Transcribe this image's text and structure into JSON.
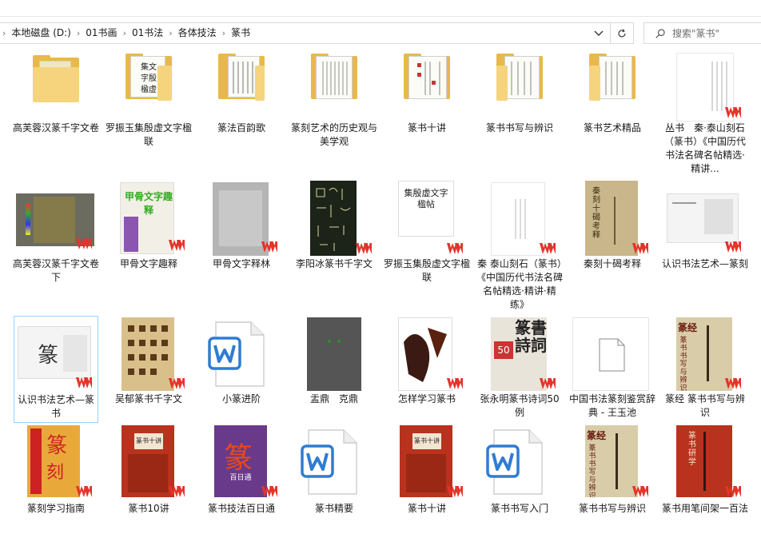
{
  "address_bar": {
    "crumbs": [
      "本地磁盘 (D:)",
      "01书画",
      "01书法",
      "各体技法",
      "篆书"
    ]
  },
  "search": {
    "placeholder": "搜索\"篆书\""
  },
  "colors": {
    "folder": "#e8b94a",
    "folder_front": "#f6d47e",
    "wps_red": "#e5332a",
    "word_blue": "#2f7cd3",
    "selection": "#99d1ff"
  },
  "rows": [
    [
      {
        "name": "高芙蓉汉篆千字文卷",
        "type": "folder"
      },
      {
        "name": "罗振玉集殷虚文字楹联",
        "type": "folder"
      },
      {
        "name": "篆法百韵歌",
        "type": "folder"
      },
      {
        "name": "篆刻艺术的历史观与美学观",
        "type": "folder"
      },
      {
        "name": "篆书十讲",
        "type": "folder"
      },
      {
        "name": "篆书书写与辨识",
        "type": "folder"
      },
      {
        "name": "篆书艺术精品",
        "type": "folder"
      },
      {
        "name": "丛书　秦·泰山刻石（篆书）《中国历代书法名碑名帖精选·精讲...",
        "type": "pdf"
      }
    ],
    [
      {
        "name": "高芙蓉汉篆千字文卷下",
        "type": "pdf"
      },
      {
        "name": "甲骨文字趣释",
        "type": "pdf"
      },
      {
        "name": "甲骨文字释林",
        "type": "pdf"
      },
      {
        "name": "李阳冰篆书千字文",
        "type": "pdf"
      },
      {
        "name": "罗振玉集殷虚文字楹联",
        "type": "pdf"
      },
      {
        "name": "秦 泰山刻石（篆书）《中国历代书法名碑名帖精选·精讲·精练》",
        "type": "pdf"
      },
      {
        "name": "秦刻十碣考释",
        "type": "pdf"
      },
      {
        "name": "认识书法艺术—篆刻",
        "type": "pdf"
      }
    ],
    [
      {
        "name": "认识书法艺术—篆书",
        "type": "pdf"
      },
      {
        "name": "吴郁篆书千字文",
        "type": "pdf"
      },
      {
        "name": "小篆进阶",
        "type": "word"
      },
      {
        "name": "盂鼎　克鼎",
        "type": "pdf"
      },
      {
        "name": "怎样学习篆书",
        "type": "pdf"
      },
      {
        "name": "张永明篆书诗词50例",
        "type": "pdf"
      },
      {
        "name": "中国书法篆刻鉴赏辞典 - 王玉池",
        "type": "blank"
      },
      {
        "name": "篆经 篆书书写与辨识",
        "type": "pdf"
      }
    ],
    [
      {
        "name": "篆刻学习指南",
        "type": "pdf"
      },
      {
        "name": "篆书10讲",
        "type": "pdf"
      },
      {
        "name": "篆书技法百日通",
        "type": "pdf"
      },
      {
        "name": "篆书精要",
        "type": "word"
      },
      {
        "name": "篆书十讲",
        "type": "pdf"
      },
      {
        "name": "篆书书写入门",
        "type": "word"
      },
      {
        "name": "篆书书写与辨识",
        "type": "pdf"
      },
      {
        "name": "篆书用笔间架一百法",
        "type": "pdf"
      }
    ]
  ],
  "cover_text": {
    "luo_zhenyu": "集殷虚文字楹帖",
    "jiagu_qushi": "甲骨文字趣释",
    "zhuanshu_shijiang": "篆书十讲",
    "zhuanshu_baiitong": "篆",
    "baiitong_sub": "百日通",
    "zhang_yongming": "篆書詩詞",
    "zhang_50": "50",
    "zhuanjing": "篆经",
    "zhuanjing_sub": "篆书书写与辨识",
    "zhuanshu_yongbi": "篆书研学",
    "qin_ke": "秦刻十碣考释"
  }
}
